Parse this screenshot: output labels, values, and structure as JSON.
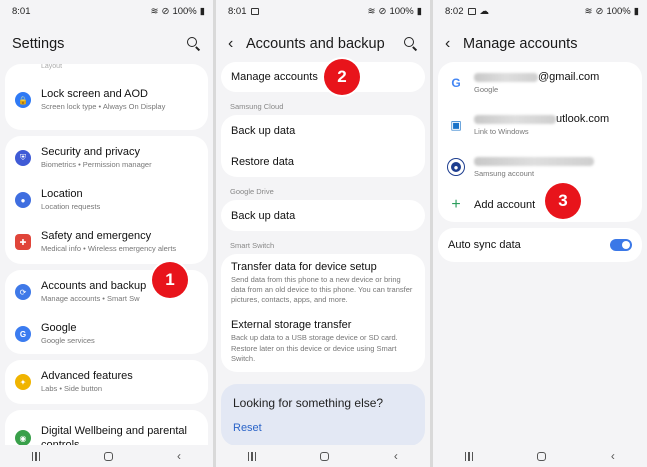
{
  "panel1": {
    "status": {
      "time": "8:01",
      "battery": "100%"
    },
    "title": "Settings",
    "partial_top": "Layout",
    "items": [
      {
        "title": "Lock screen and AOD",
        "sub": "Screen lock type  •  Always On Display",
        "color": "#2f7af5"
      },
      {
        "title": "Security and privacy",
        "sub": "Biometrics  •  Permission manager",
        "color": "#3f5bd6"
      },
      {
        "title": "Location",
        "sub": "Location requests",
        "color": "#3f6ee0"
      },
      {
        "title": "Safety and emergency",
        "sub": "Medical info  •  Wireless emergency alerts",
        "color": "#e0453a"
      },
      {
        "title": "Accounts and backup",
        "sub": "Manage accounts  •  Smart Sw",
        "color": "#3f79e8"
      },
      {
        "title": "Google",
        "sub": "Google services",
        "color": "#3b7cf0"
      },
      {
        "title": "Advanced features",
        "sub": "Labs  •  Side button",
        "color": "#f0b400"
      },
      {
        "title": "Digital Wellbeing and parental controls",
        "sub": "",
        "color": "#39a04a"
      }
    ],
    "badge": "1"
  },
  "panel2": {
    "status": {
      "time": "8:01",
      "battery": "100%"
    },
    "title": "Accounts and backup",
    "manage": "Manage accounts",
    "badge": "2",
    "samsung_cloud_label": "Samsung Cloud",
    "backup_data": "Back up data",
    "restore_data": "Restore data",
    "google_drive_label": "Google Drive",
    "drive_backup": "Back up data",
    "smart_switch_label": "Smart Switch",
    "transfer_title": "Transfer data for device setup",
    "transfer_sub": "Send data from this phone to a new device or bring data from an old device to this phone. You can transfer pictures, contacts, apps, and more.",
    "external_title": "External storage transfer",
    "external_sub": "Back up data to a USB storage device or SD card. Restore later on this device or device using Smart Switch.",
    "looking": "Looking for something else?",
    "reset": "Reset"
  },
  "panel3": {
    "status": {
      "time": "8:02",
      "battery": "100%"
    },
    "title": "Manage accounts",
    "accounts": [
      {
        "email_suffix": "@gmail.com",
        "type": "Google"
      },
      {
        "email_suffix": "utlook.com",
        "type": "Link to Windows"
      },
      {
        "email_suffix": "",
        "type": "Samsung account"
      }
    ],
    "add_account": "Add account",
    "badge": "3",
    "auto_sync": "Auto sync data"
  },
  "colors": {
    "badge": "#e8141b",
    "toggle": "#3b78e7",
    "link": "#2b64c8"
  }
}
